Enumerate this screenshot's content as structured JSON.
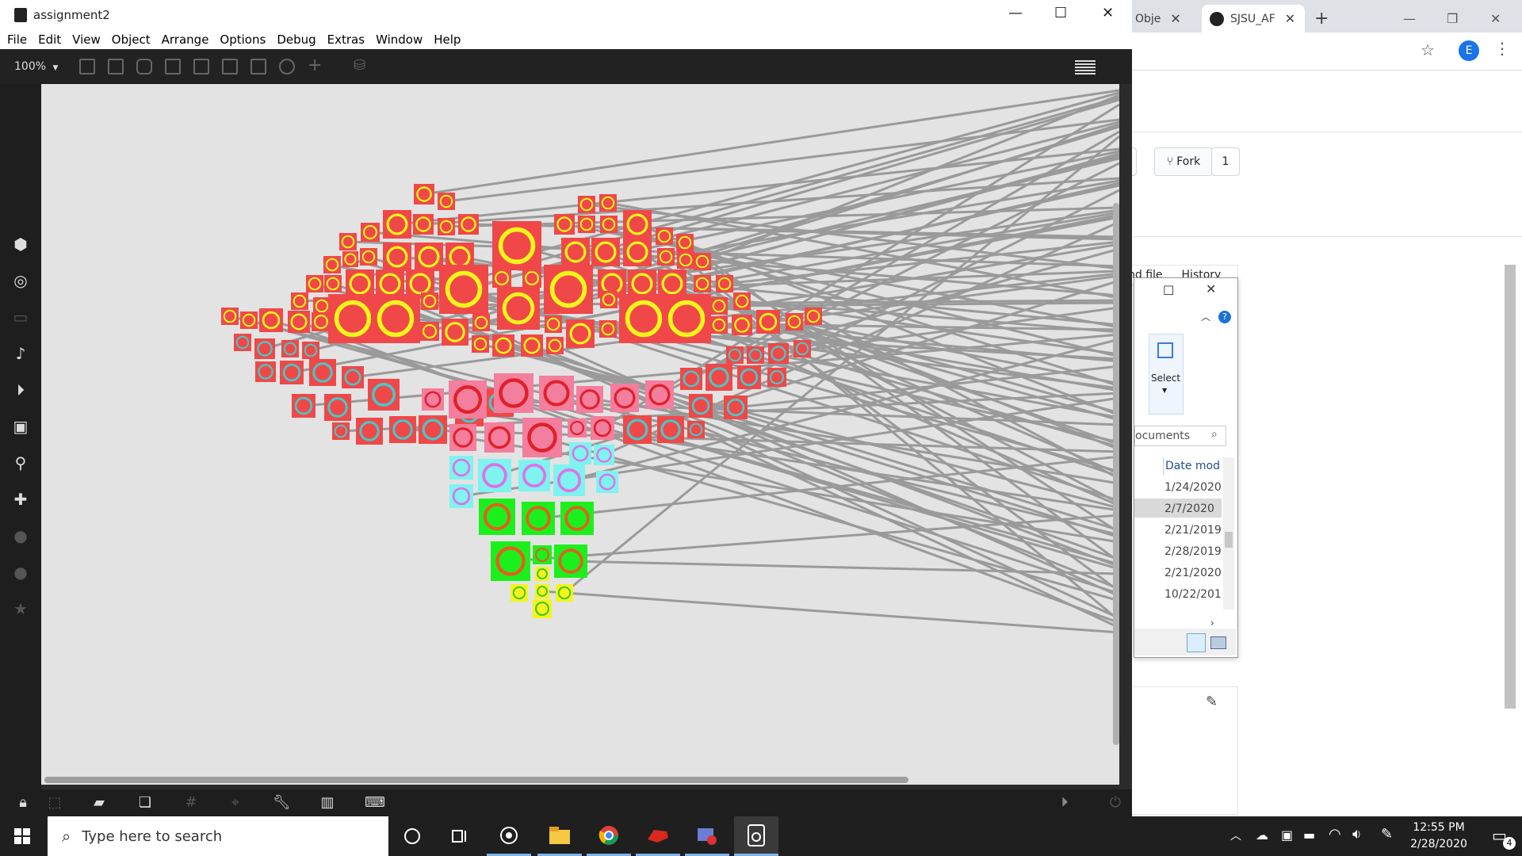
{
  "app": {
    "title": "assignment2",
    "menu": [
      "File",
      "Edit",
      "View",
      "Object",
      "Arrange",
      "Options",
      "Debug",
      "Extras",
      "Window",
      "Help"
    ],
    "zoom": "100%",
    "zoom_arrow": "▼"
  },
  "browser": {
    "tabs": [
      {
        "label": "Obje"
      },
      {
        "label": "SJSU_AF"
      }
    ],
    "avatar_letter": "E",
    "fork_label": "Fork",
    "fork_count": "1",
    "file_tabs": [
      "nd file",
      "History"
    ]
  },
  "explorer": {
    "select_label": "Select",
    "search_placeholder": "ocuments",
    "column_header": "Date mod",
    "rows": [
      "1/24/2020",
      "2/7/2020",
      "2/21/2019",
      "2/28/2019",
      "2/21/2020",
      "10/22/201"
    ],
    "selected_row": 1
  },
  "taskbar": {
    "search_placeholder": "Type here to search",
    "time": "12:55 PM",
    "date": "2/28/2020",
    "notification_count": "4"
  },
  "colors": {
    "red_tile": "#f04848",
    "pink_tile": "#f37e9d",
    "cyan_tile": "#7ef3ef",
    "green_tile": "#1cf01c",
    "yellow_tile": "#f5f51c",
    "line": "#9a9a9a",
    "canvas": "#e3e3e3"
  }
}
